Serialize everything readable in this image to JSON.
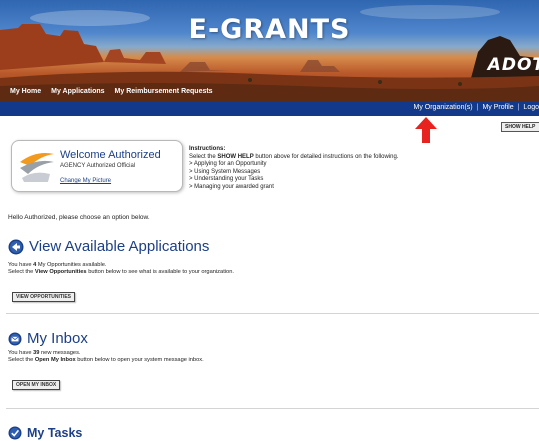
{
  "header": {
    "title": "E-GRANTS",
    "logo_text": "ADOT",
    "nav": [
      "My Home",
      "My Applications",
      "My Reimbursement Requests"
    ]
  },
  "subbar": {
    "links": [
      "My Organization(s)",
      "My Profile",
      "Logo"
    ]
  },
  "show_help_label": "SHOW HELP",
  "welcome": {
    "title": "Welcome Authorized",
    "subtitle": "AGENCY Authorized Official",
    "change_picture": "Change My Picture"
  },
  "instructions": {
    "heading": "Instructions:",
    "line1_pre": "Select the ",
    "line1_bold": "SHOW HELP",
    "line1_post": " button above for detailed instructions on the following.",
    "items": [
      "Applying for an Opportunity",
      "Using System Messages",
      "Understanding your Tasks",
      "Managing your awarded grant"
    ]
  },
  "greeting": "Hello Authorized, please choose an option below.",
  "applications": {
    "title": "View Available Applications",
    "line1_pre": "You have ",
    "count": "4",
    "line1_post": " My Opportunities available.",
    "line2_pre": "Select the ",
    "line2_bold": "View Opportunities",
    "line2_post": " button below to see what is available to your organization.",
    "button": "VIEW OPPORTUNITIES"
  },
  "inbox": {
    "title": "My Inbox",
    "line1_pre": "You have ",
    "count": "39",
    "line1_post": " new messages.",
    "line2_pre": "Select the ",
    "line2_bold": "Open My Inbox",
    "line2_post": " button below to open your system message inbox.",
    "button": "OPEN MY INBOX"
  },
  "tasks": {
    "title": "My Tasks"
  },
  "colors": {
    "nav_bar": "#133a8a",
    "heading_blue": "#1c3f86",
    "arrow": "#e8231f"
  }
}
